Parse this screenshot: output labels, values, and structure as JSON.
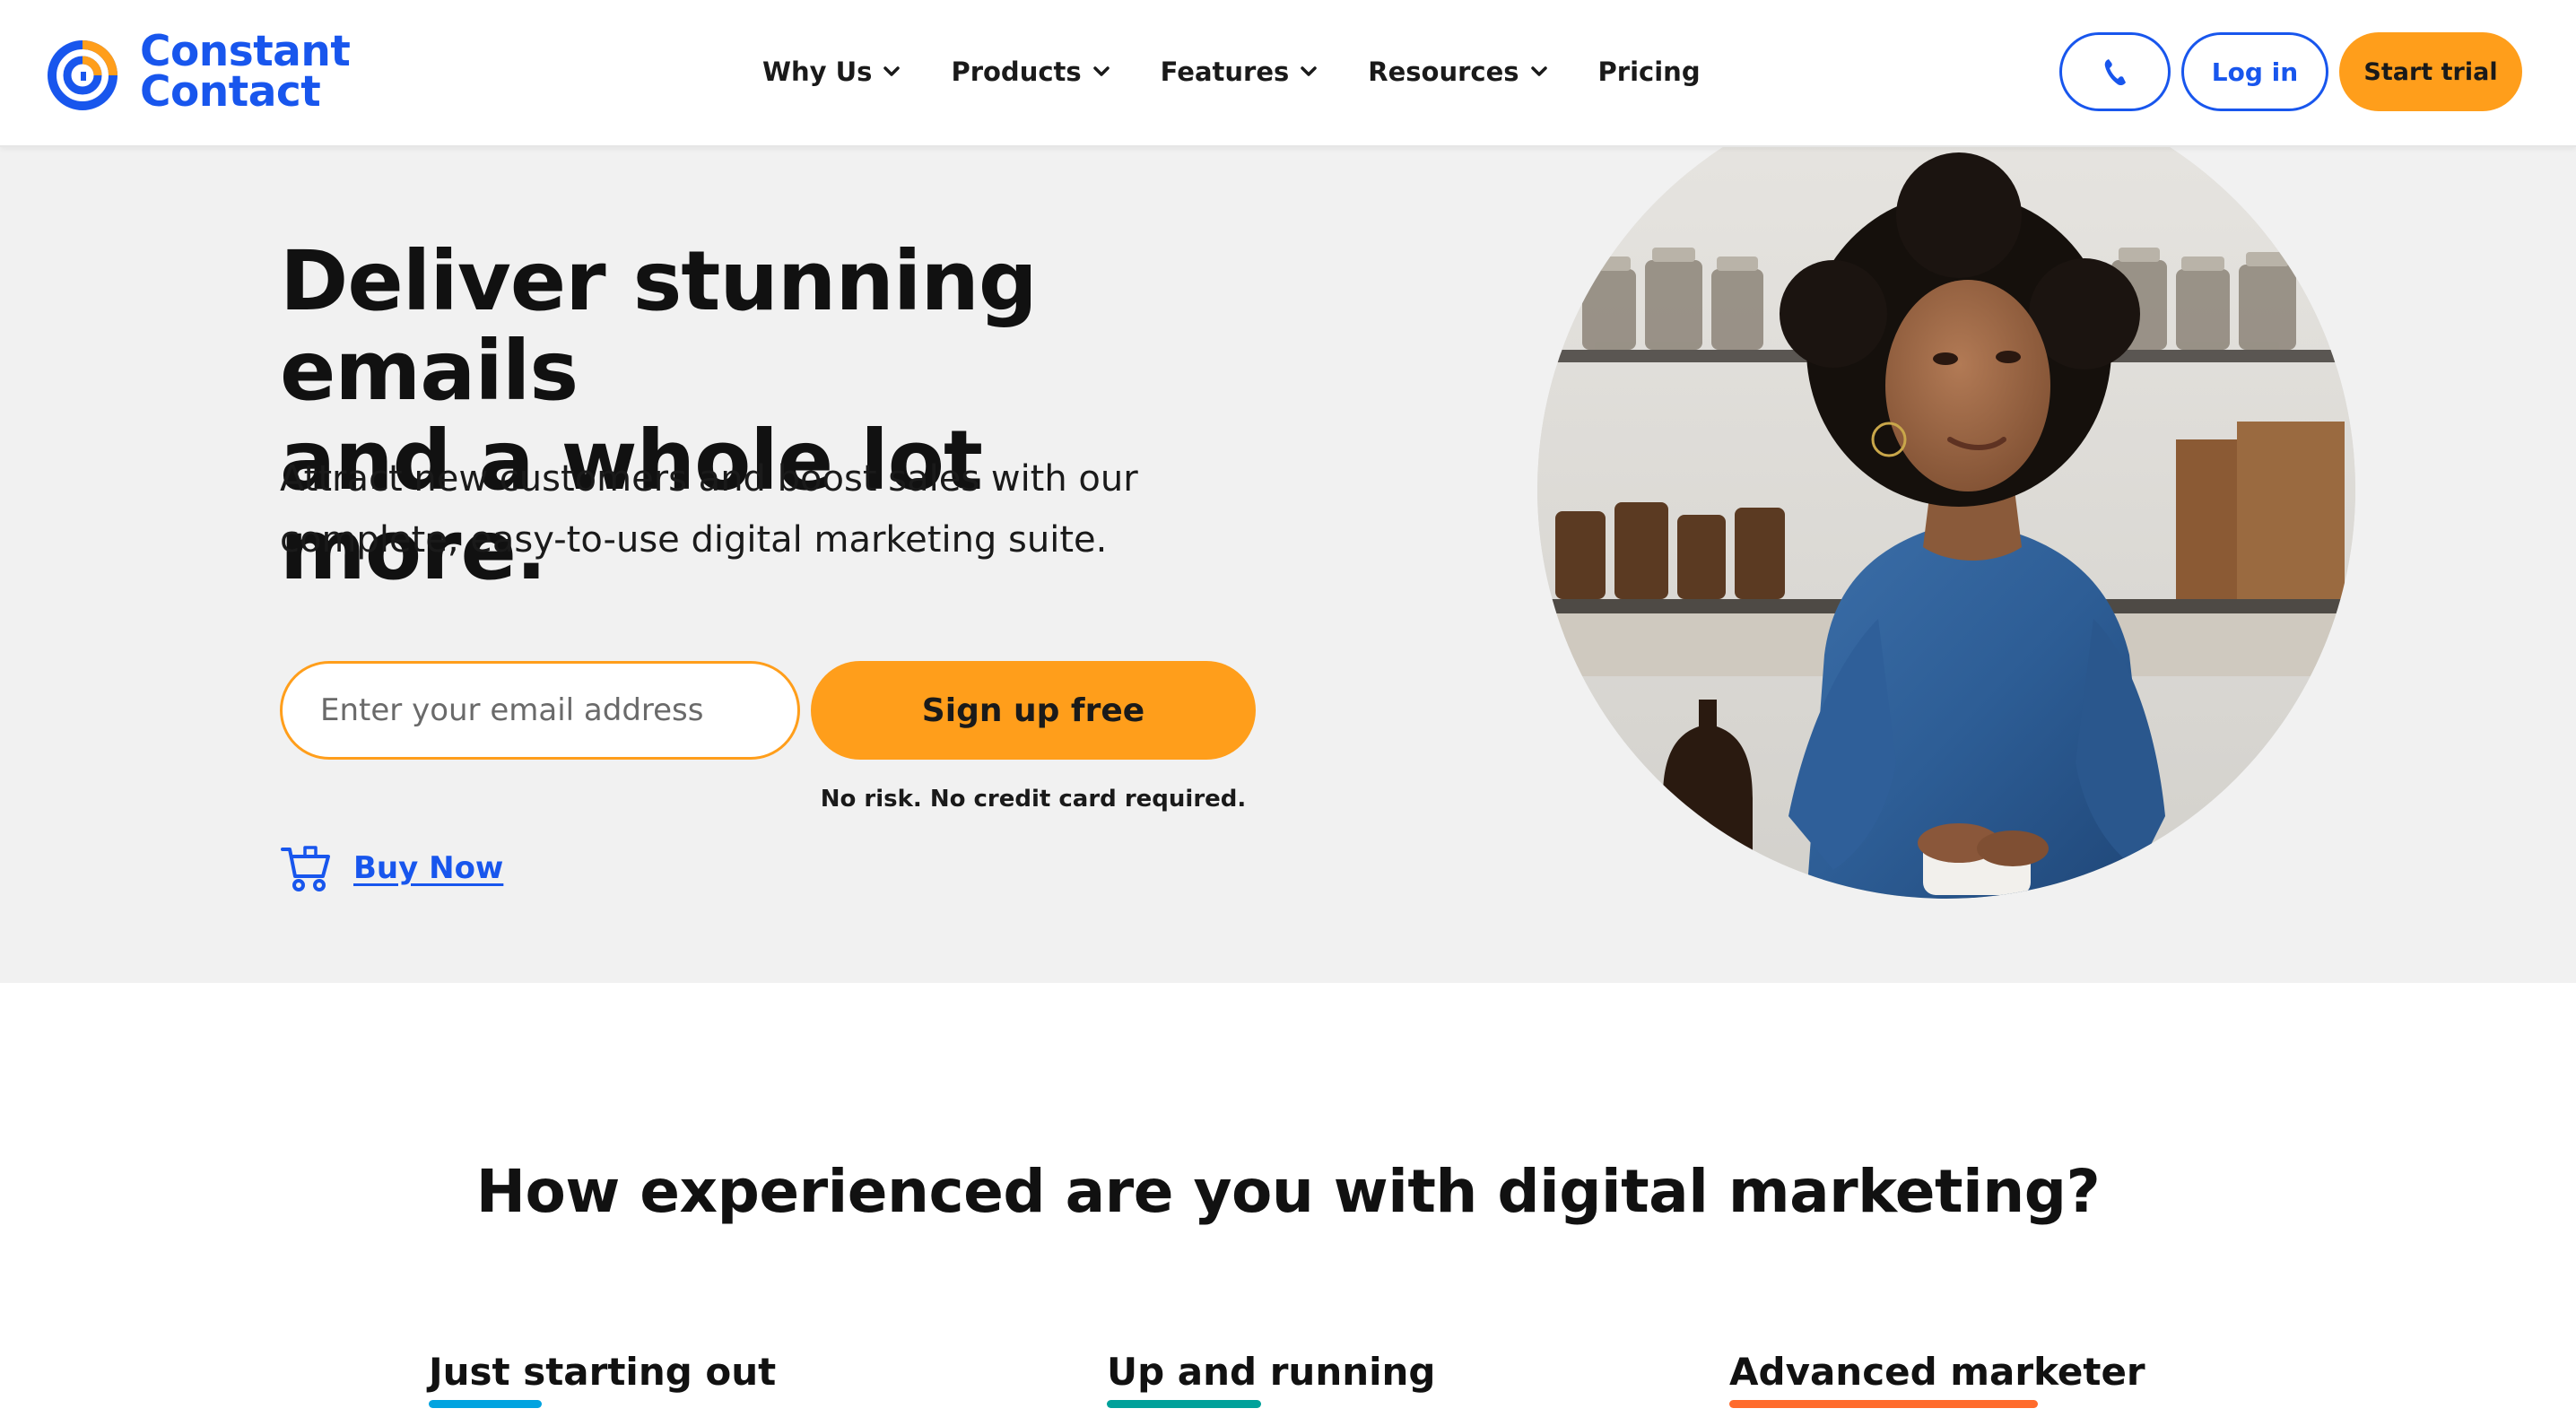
{
  "brand": {
    "name_line1": "Constant",
    "name_line2": "Contact",
    "colors": {
      "primary": "#1856ed",
      "accent": "#ff9e1b"
    }
  },
  "nav": {
    "items": [
      {
        "label": "Why Us",
        "has_dropdown": true
      },
      {
        "label": "Products",
        "has_dropdown": true
      },
      {
        "label": "Features",
        "has_dropdown": true
      },
      {
        "label": "Resources",
        "has_dropdown": true
      },
      {
        "label": "Pricing",
        "has_dropdown": false
      }
    ],
    "phone_icon": "phone-icon",
    "login_label": "Log in",
    "trial_label": "Start trial"
  },
  "hero": {
    "title_line1": "Deliver stunning emails",
    "title_line2": "and a whole lot more.",
    "subtitle_line1": "Attract new customers and boost sales with our",
    "subtitle_line2": "complete, easy-to-use digital marketing suite.",
    "email_placeholder": "Enter your email address",
    "signup_label": "Sign up free",
    "no_risk": "No risk. No credit card required.",
    "buy_now": "Buy Now",
    "cart_icon": "shopping-cart-icon"
  },
  "experience": {
    "question": "How experienced are you with digital marketing?",
    "tabs": [
      {
        "label": "Just starting out",
        "color": "#00a3e0"
      },
      {
        "label": "Up and running",
        "color": "#00a19a"
      },
      {
        "label": "Advanced marketer",
        "color": "#ff6b2c"
      }
    ]
  }
}
